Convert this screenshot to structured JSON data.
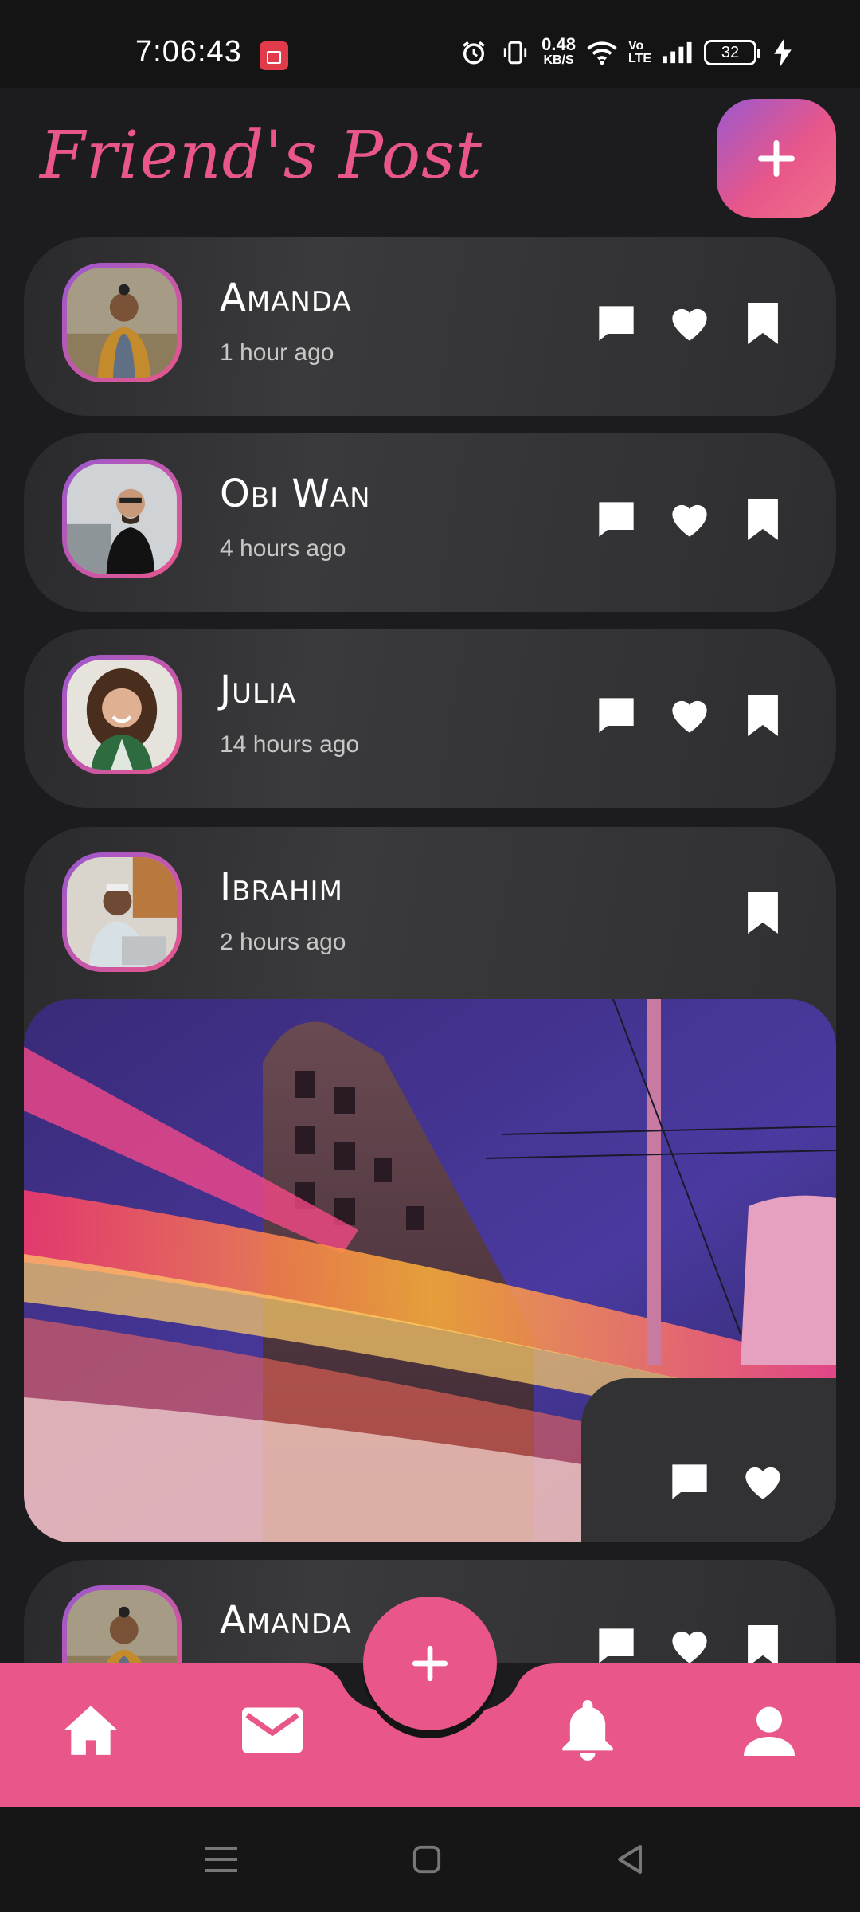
{
  "status_bar": {
    "time": "7:06:43",
    "net_speed": "0.48",
    "net_unit": "KB/S",
    "volte": "Vo\nLTE",
    "battery": "32"
  },
  "header": {
    "title": "Friend's Post",
    "add_icon": "plus-icon"
  },
  "posts": [
    {
      "name": "Amanda",
      "time": "1 hour ago",
      "avatar": "person-with-headphones"
    },
    {
      "name": "Obi Wan",
      "time": "4 hours ago",
      "avatar": "bearded-man-with-glasses"
    },
    {
      "name": "Julia",
      "time": "14 hours ago",
      "avatar": "smiling-woman-curly-hair"
    },
    {
      "name": "Ibrahim",
      "time": "2 hours ago",
      "avatar": "man-with-headphones-at-laptop",
      "image": "city-night-light-trails"
    },
    {
      "name": "Amanda",
      "time": "",
      "avatar": "person-with-headphones"
    }
  ],
  "bottom_nav": {
    "items": [
      "home-icon",
      "mail-icon",
      "bell-icon",
      "person-icon"
    ],
    "fab_icon": "plus-icon"
  },
  "colors": {
    "accent": "#e8568a",
    "accent_purple": "#9b59d0",
    "background": "#1c1c1e",
    "card": "#333335"
  }
}
